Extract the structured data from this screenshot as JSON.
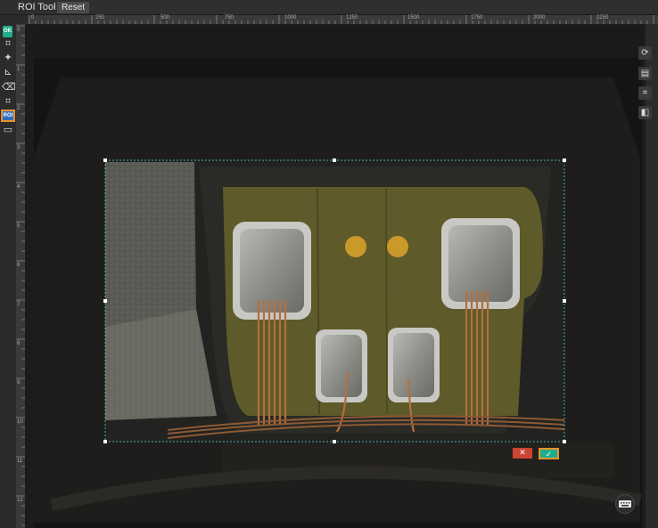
{
  "toolbar": {
    "title": "ROI Tool",
    "reset_label": "Reset"
  },
  "left_tools": [
    {
      "name": "ok-icon",
      "label": "OK"
    },
    {
      "name": "polygon-select-icon",
      "label": "⌗"
    },
    {
      "name": "magic-wand-icon",
      "label": "✦"
    },
    {
      "name": "polygon-icon",
      "label": "⊾"
    },
    {
      "name": "eraser-icon",
      "label": "⌫"
    },
    {
      "name": "crop-icon",
      "label": "⌗"
    },
    {
      "name": "roi-icon",
      "label": "ROI"
    },
    {
      "name": "rect-select-icon",
      "label": "▭"
    }
  ],
  "ruler_top": [
    "0",
    "250",
    "500",
    "750",
    "1000",
    "1250",
    "1500",
    "1750",
    "2000",
    "2250"
  ],
  "ruler_left": [
    "0",
    "1",
    "2",
    "3",
    "4",
    "5",
    "6",
    "7",
    "8",
    "9",
    "10",
    "11",
    "12"
  ],
  "roi": {
    "cancel_label": "✕",
    "confirm_label": "✓"
  },
  "right_tools": [
    "route-icon",
    "document-icon",
    "crop-grid-icon",
    "layer-icon"
  ],
  "colors": {
    "accent": "#e8922a",
    "ok_green": "#1fae8c",
    "cancel_red": "#cc4433",
    "roi_border": "#3fb8a8"
  }
}
